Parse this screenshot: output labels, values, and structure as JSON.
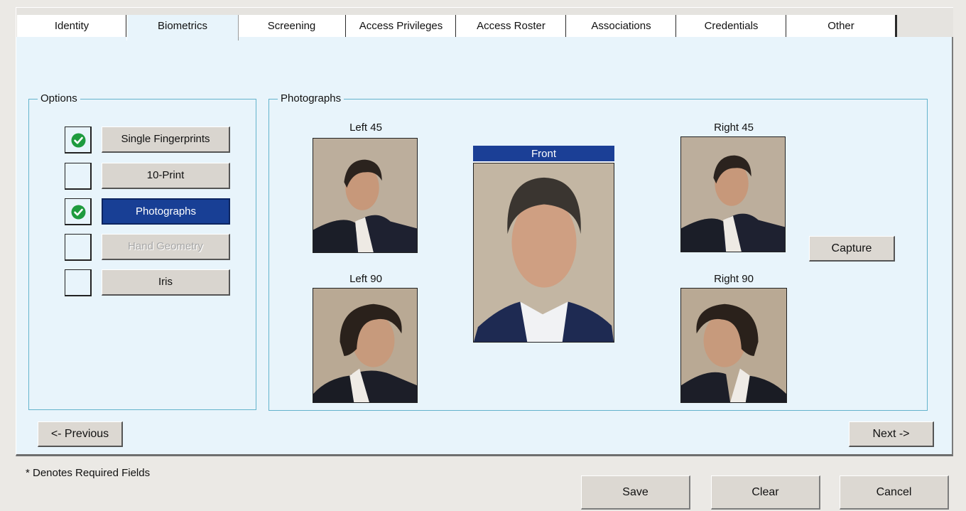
{
  "tabs": [
    {
      "label": "Identity"
    },
    {
      "label": "Biometrics"
    },
    {
      "label": "Screening"
    },
    {
      "label": "Access Privileges"
    },
    {
      "label": "Access Roster"
    },
    {
      "label": "Associations"
    },
    {
      "label": "Credentials"
    },
    {
      "label": "Other"
    }
  ],
  "active_tab": "Biometrics",
  "options": {
    "legend": "Options",
    "items": [
      {
        "label": "Single Fingerprints",
        "checked": true,
        "selected": false,
        "enabled": true
      },
      {
        "label": "10-Print",
        "checked": false,
        "selected": false,
        "enabled": true
      },
      {
        "label": "Photographs",
        "checked": true,
        "selected": true,
        "enabled": true
      },
      {
        "label": "Hand Geometry",
        "checked": false,
        "selected": false,
        "enabled": false
      },
      {
        "label": "Iris",
        "checked": false,
        "selected": false,
        "enabled": true
      }
    ]
  },
  "photographs": {
    "legend": "Photographs",
    "left45": "Left 45",
    "left90": "Left 90",
    "front": "Front",
    "right45": "Right 45",
    "right90": "Right 90",
    "capture_label": "Capture"
  },
  "nav": {
    "previous_label": "<- Previous",
    "next_label": "Next ->"
  },
  "footer": {
    "note": "* Denotes Required Fields",
    "save_label": "Save",
    "clear_label": "Clear",
    "cancel_label": "Cancel"
  },
  "colors": {
    "panel_bg": "#e8f4fb",
    "group_border": "#63b3cc",
    "selected_button": "#183f95",
    "check_green": "#1e9b3e"
  }
}
